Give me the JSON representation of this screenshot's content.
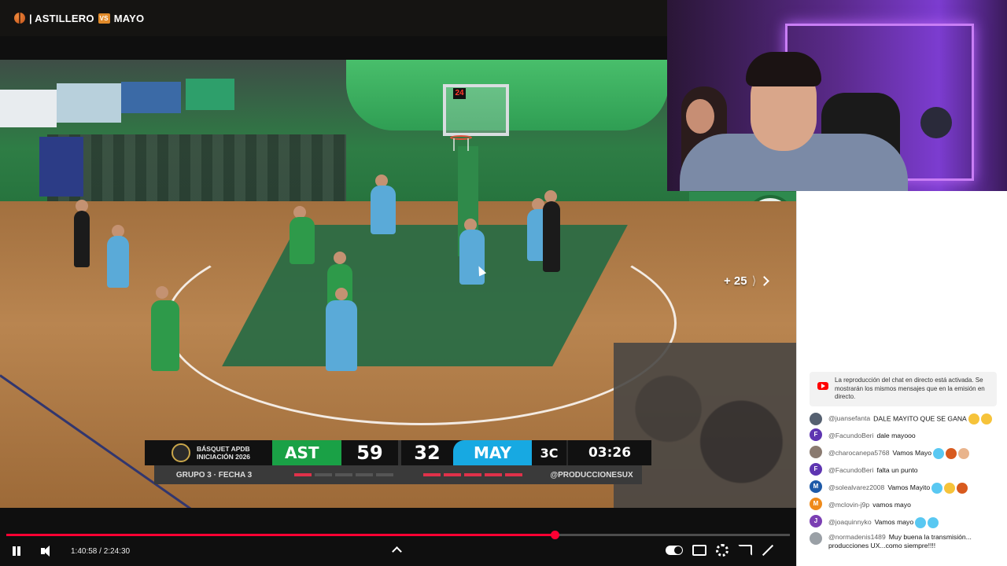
{
  "stream": {
    "title_left": "| ASTILLERO",
    "vs_badge": "VS",
    "title_right": "MAYO"
  },
  "video": {
    "shot_clock": "24",
    "more_label": "+ 25",
    "more_separator": "⟩"
  },
  "scoreboard": {
    "league_line1": "BÁSQUET APDB",
    "league_line2": "INICIACIÓN 2026",
    "home_team": "AST",
    "home_score": "59",
    "away_score": "32",
    "away_team": "MAY",
    "period": "3C",
    "clock": "03:26",
    "group": "GRUPO 3 · FECHA 3",
    "producer": "@PRODUCCIONESUX",
    "home_fouls": 1,
    "away_fouls": 5,
    "colors": {
      "home": "#1aa146",
      "away": "#17a9e2",
      "foul": "#e0314a"
    }
  },
  "player": {
    "current_time": "1:40:58",
    "separator": " / ",
    "duration": "2:24:30",
    "progress_fraction": 0.7
  },
  "actions": [
    "like-icon",
    "dislike-icon",
    "comment-icon",
    "chat-icon",
    "share-icon",
    "sparkle-icon"
  ],
  "chat": {
    "notice": "La reproducción del chat en directo está activada. Se mostrarán los mismos mensajes que en la emisión en directo.",
    "messages": [
      {
        "author": "@juansefanta",
        "text": "DALE MAYITO QUE SE GANA",
        "avatar": "",
        "avatar_color": "#556070",
        "emojis": [
          "e-muscle",
          "e-hands"
        ],
        "two_line": true
      },
      {
        "author": "@FacundoBeri",
        "text": "dale mayooo",
        "avatar": "F",
        "avatar_color": "#5e35b1",
        "emojis": []
      },
      {
        "author": "@charocanepa5768",
        "text": "Vamos Mayo",
        "avatar": "",
        "avatar_color": "#8a7a70",
        "emojis": [
          "e-heart",
          "e-ball",
          "e-muscle2"
        ]
      },
      {
        "author": "@FacundoBeri",
        "text": "falta un punto",
        "avatar": "F",
        "avatar_color": "#5e35b1",
        "emojis": []
      },
      {
        "author": "@solealvarez2008",
        "text": "Vamos Mayito",
        "avatar": "M",
        "avatar_color": "#1e5aa8",
        "emojis": [
          "e-heart",
          "e-muscle",
          "e-ball"
        ]
      },
      {
        "author": "@mclovin-j9p",
        "text": "vamos mayo",
        "avatar": "M",
        "avatar_color": "#ef8a1a",
        "emojis": []
      },
      {
        "author": "@joaquinnyko",
        "text": "Vamos mayo",
        "avatar": "J",
        "avatar_color": "#7b3fb3",
        "emojis": [
          "e-heart",
          "e-heart"
        ]
      },
      {
        "author": "@normadenis1489",
        "text": "Muy buena la transmisión... producciones UX...como siempre!!!!",
        "avatar": "",
        "avatar_color": "#9aa0a6",
        "emojis": [],
        "two_line": true
      }
    ]
  }
}
